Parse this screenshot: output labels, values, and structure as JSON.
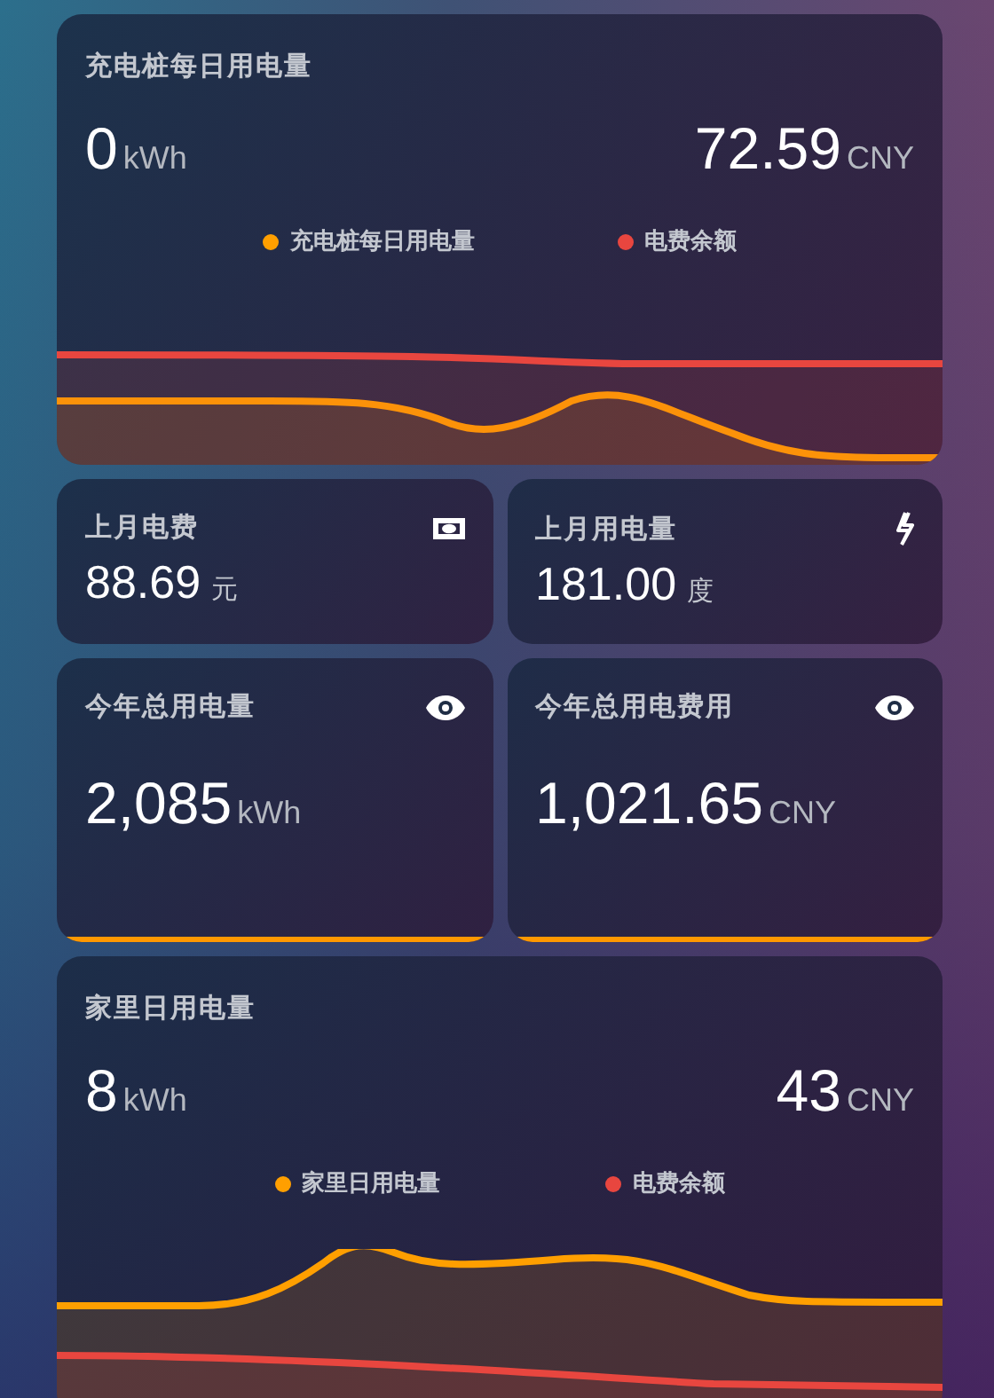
{
  "cards": [
    {
      "kind": "graph",
      "title": "充电桩每日用电量",
      "primary": {
        "value": "0",
        "unit": "kWh"
      },
      "secondary": {
        "value": "72.59",
        "unit": "CNY"
      },
      "legend": [
        {
          "label": "充电桩每日用电量",
          "color": "#ff9f00"
        },
        {
          "label": "电费余额",
          "color": "#e8463f"
        }
      ]
    },
    {
      "kind": "compact",
      "title": "上月电费",
      "value": "88.69",
      "unit": "元"
    },
    {
      "kind": "compact",
      "title": "上月用电量",
      "value": "181.00",
      "unit": "度"
    },
    {
      "kind": "total",
      "title": "今年总用电量",
      "value": "2,085",
      "unit": "kWh"
    },
    {
      "kind": "total",
      "title": "今年总用电费用",
      "value": "1,021.65",
      "unit": "CNY"
    },
    {
      "kind": "graph",
      "title": "家里日用电量",
      "primary": {
        "value": "8",
        "unit": "kWh"
      },
      "secondary": {
        "value": "43",
        "unit": "CNY"
      },
      "legend": [
        {
          "label": "家里日用电量",
          "color": "#ff9f00"
        },
        {
          "label": "电费余额",
          "color": "#e8463f"
        }
      ]
    }
  ]
}
